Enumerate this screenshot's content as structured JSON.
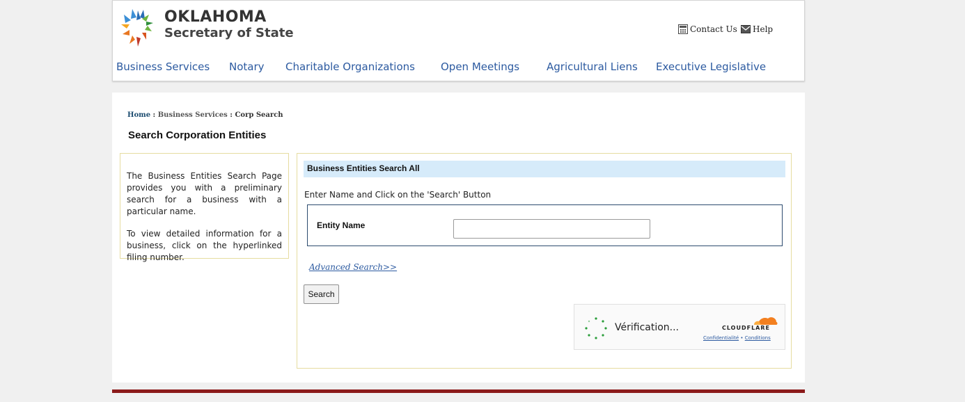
{
  "header": {
    "logo_title": "OKLAHOMA",
    "logo_subtitle": "Secretary of State",
    "contact_label": "Contact Us",
    "help_label": "Help"
  },
  "nav": {
    "items": [
      {
        "label": "Business Services"
      },
      {
        "label": "Notary"
      },
      {
        "label": "Charitable Organizations"
      },
      {
        "label": "Open Meetings"
      },
      {
        "label": "Agricultural Liens"
      },
      {
        "label": "Executive Legislative"
      }
    ]
  },
  "breadcrumb": {
    "home": "Home",
    "sep1": " : ",
    "business_services": "Business Services",
    "sep2": " : ",
    "current": "Corp Search"
  },
  "page_title": "Search Corporation Entities",
  "info": {
    "para1": "The Business Entities Search Page provides you with a preliminary search for a business with a particular name.",
    "para2": "To view detailed information for a business, click on the hyperlinked filing number."
  },
  "search": {
    "header": "Business Entities Search All",
    "instruction": "Enter Name and Click on the 'Search' Button",
    "entity_label": "Entity Name",
    "entity_value": "",
    "advanced_link": "Advanced Search>>",
    "search_button": "Search"
  },
  "cloudflare": {
    "status": "Vérification...",
    "brand": "CLOUDFLARE",
    "privacy": "Confidentialité",
    "dot": " • ",
    "terms": "Conditions"
  },
  "colors": {
    "nav_link": "#2c5aa0",
    "search_header_bg": "#d6ebfa",
    "box_border": "#e6dca0",
    "footer_bar": "#8b1a1a",
    "cloudflare_orange": "#f38020"
  }
}
